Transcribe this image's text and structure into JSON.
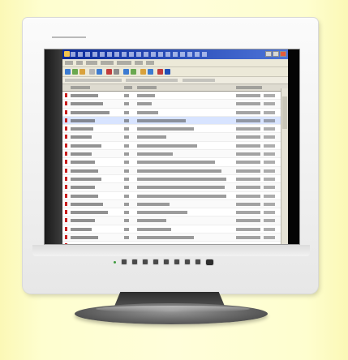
{
  "scene": {
    "subject": "monitor",
    "background_color": "#fdfcc4",
    "screen_app": {
      "window_icon": "mail-app-icon",
      "title_bar_color": "#1a3fb0",
      "flag_color": "#c91c1c",
      "row_count": 19
    },
    "control_buttons": 9
  }
}
